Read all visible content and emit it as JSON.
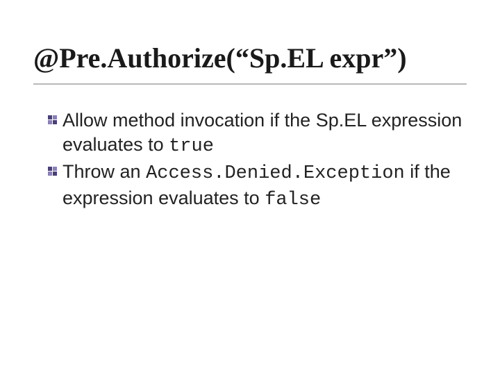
{
  "title": "@Pre.Authorize(“Sp.EL expr”)",
  "bullets": [
    {
      "pre": "Allow method invocation if the Sp.EL expression evaluates to ",
      "code": "true",
      "post": ""
    },
    {
      "pre": "Throw an ",
      "code": "Access.Denied.Exception",
      "post": " if the expression evaluates to ",
      "code2": "false"
    }
  ]
}
